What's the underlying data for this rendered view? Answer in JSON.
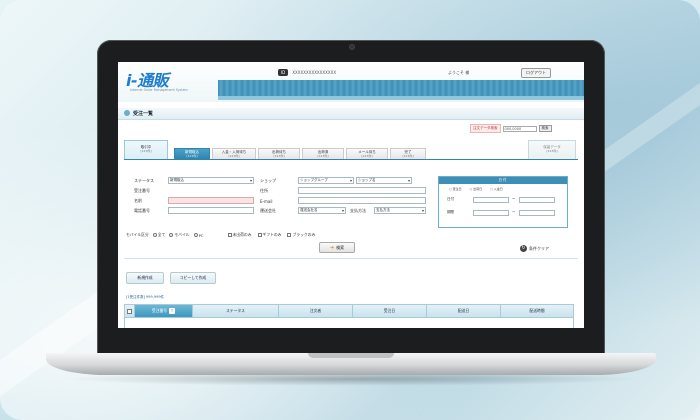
{
  "header": {
    "logo_main": "i-通販",
    "logo_sub": "Internet Order Management System",
    "id_label": "ID",
    "user_id": "XXXXXXXXXXXXXXXX",
    "welcome": "ようこそ 様",
    "logout": "ログアウト"
  },
  "page": {
    "title": "受注一覧"
  },
  "quick_search": {
    "label": "注文データ検索",
    "placeholder": "000,0000",
    "button": "検索"
  },
  "tabs": [
    {
      "label": "取引中",
      "count": "[123件]"
    },
    {
      "label": "新規取込",
      "count": "[123件]"
    },
    {
      "label": "入金・入荷待ち",
      "count": "[123件]"
    },
    {
      "label": "出荷待ち",
      "count": "[123件]"
    },
    {
      "label": "出荷済",
      "count": "[123件]"
    },
    {
      "label": "メール待ち",
      "count": "[123件]"
    },
    {
      "label": "完了",
      "count": "[123件]"
    },
    {
      "label": "保留データ",
      "count": "[123件]"
    }
  ],
  "form": {
    "status_label": "ステータス",
    "status_value": "新規取込",
    "order_no_label": "受注番号",
    "name_label": "名前",
    "phone_label": "電話番号",
    "shop_label": "ショップ",
    "shop_group_value": "ショップグループ",
    "shop_value": "ショップ名",
    "address_label": "住所",
    "email_label": "E-mail",
    "delivery_label": "運送会社",
    "delivery_value": "運送会社名",
    "payment_label": "支払方法",
    "payment_value": "支払方法"
  },
  "date_box": {
    "title": "日付",
    "radios": [
      "受注日",
      "出荷日",
      "入金日"
    ],
    "from_label": "日付",
    "to_label": "期間"
  },
  "options": {
    "mobile_label": "モバイル区分",
    "all": "全て",
    "mobile": "モバイル",
    "pc": "PC",
    "unshipped": "未出荷のみ",
    "gift": "ギフトのみ",
    "black": "ブラックのみ"
  },
  "buttons": {
    "search": "検索",
    "clear": "条件クリア",
    "new": "新規作成",
    "copy": "コピーして作成"
  },
  "results_count": "[1受注件数] 999,999件",
  "table": {
    "columns": [
      "受注番号",
      "ステータス",
      "注文者",
      "受注日",
      "配送日",
      "配送時間"
    ]
  },
  "colors": {
    "brand": "#1f7dd0",
    "header_bar": "#3d8fb6",
    "active_tab": "#2f85ad"
  }
}
